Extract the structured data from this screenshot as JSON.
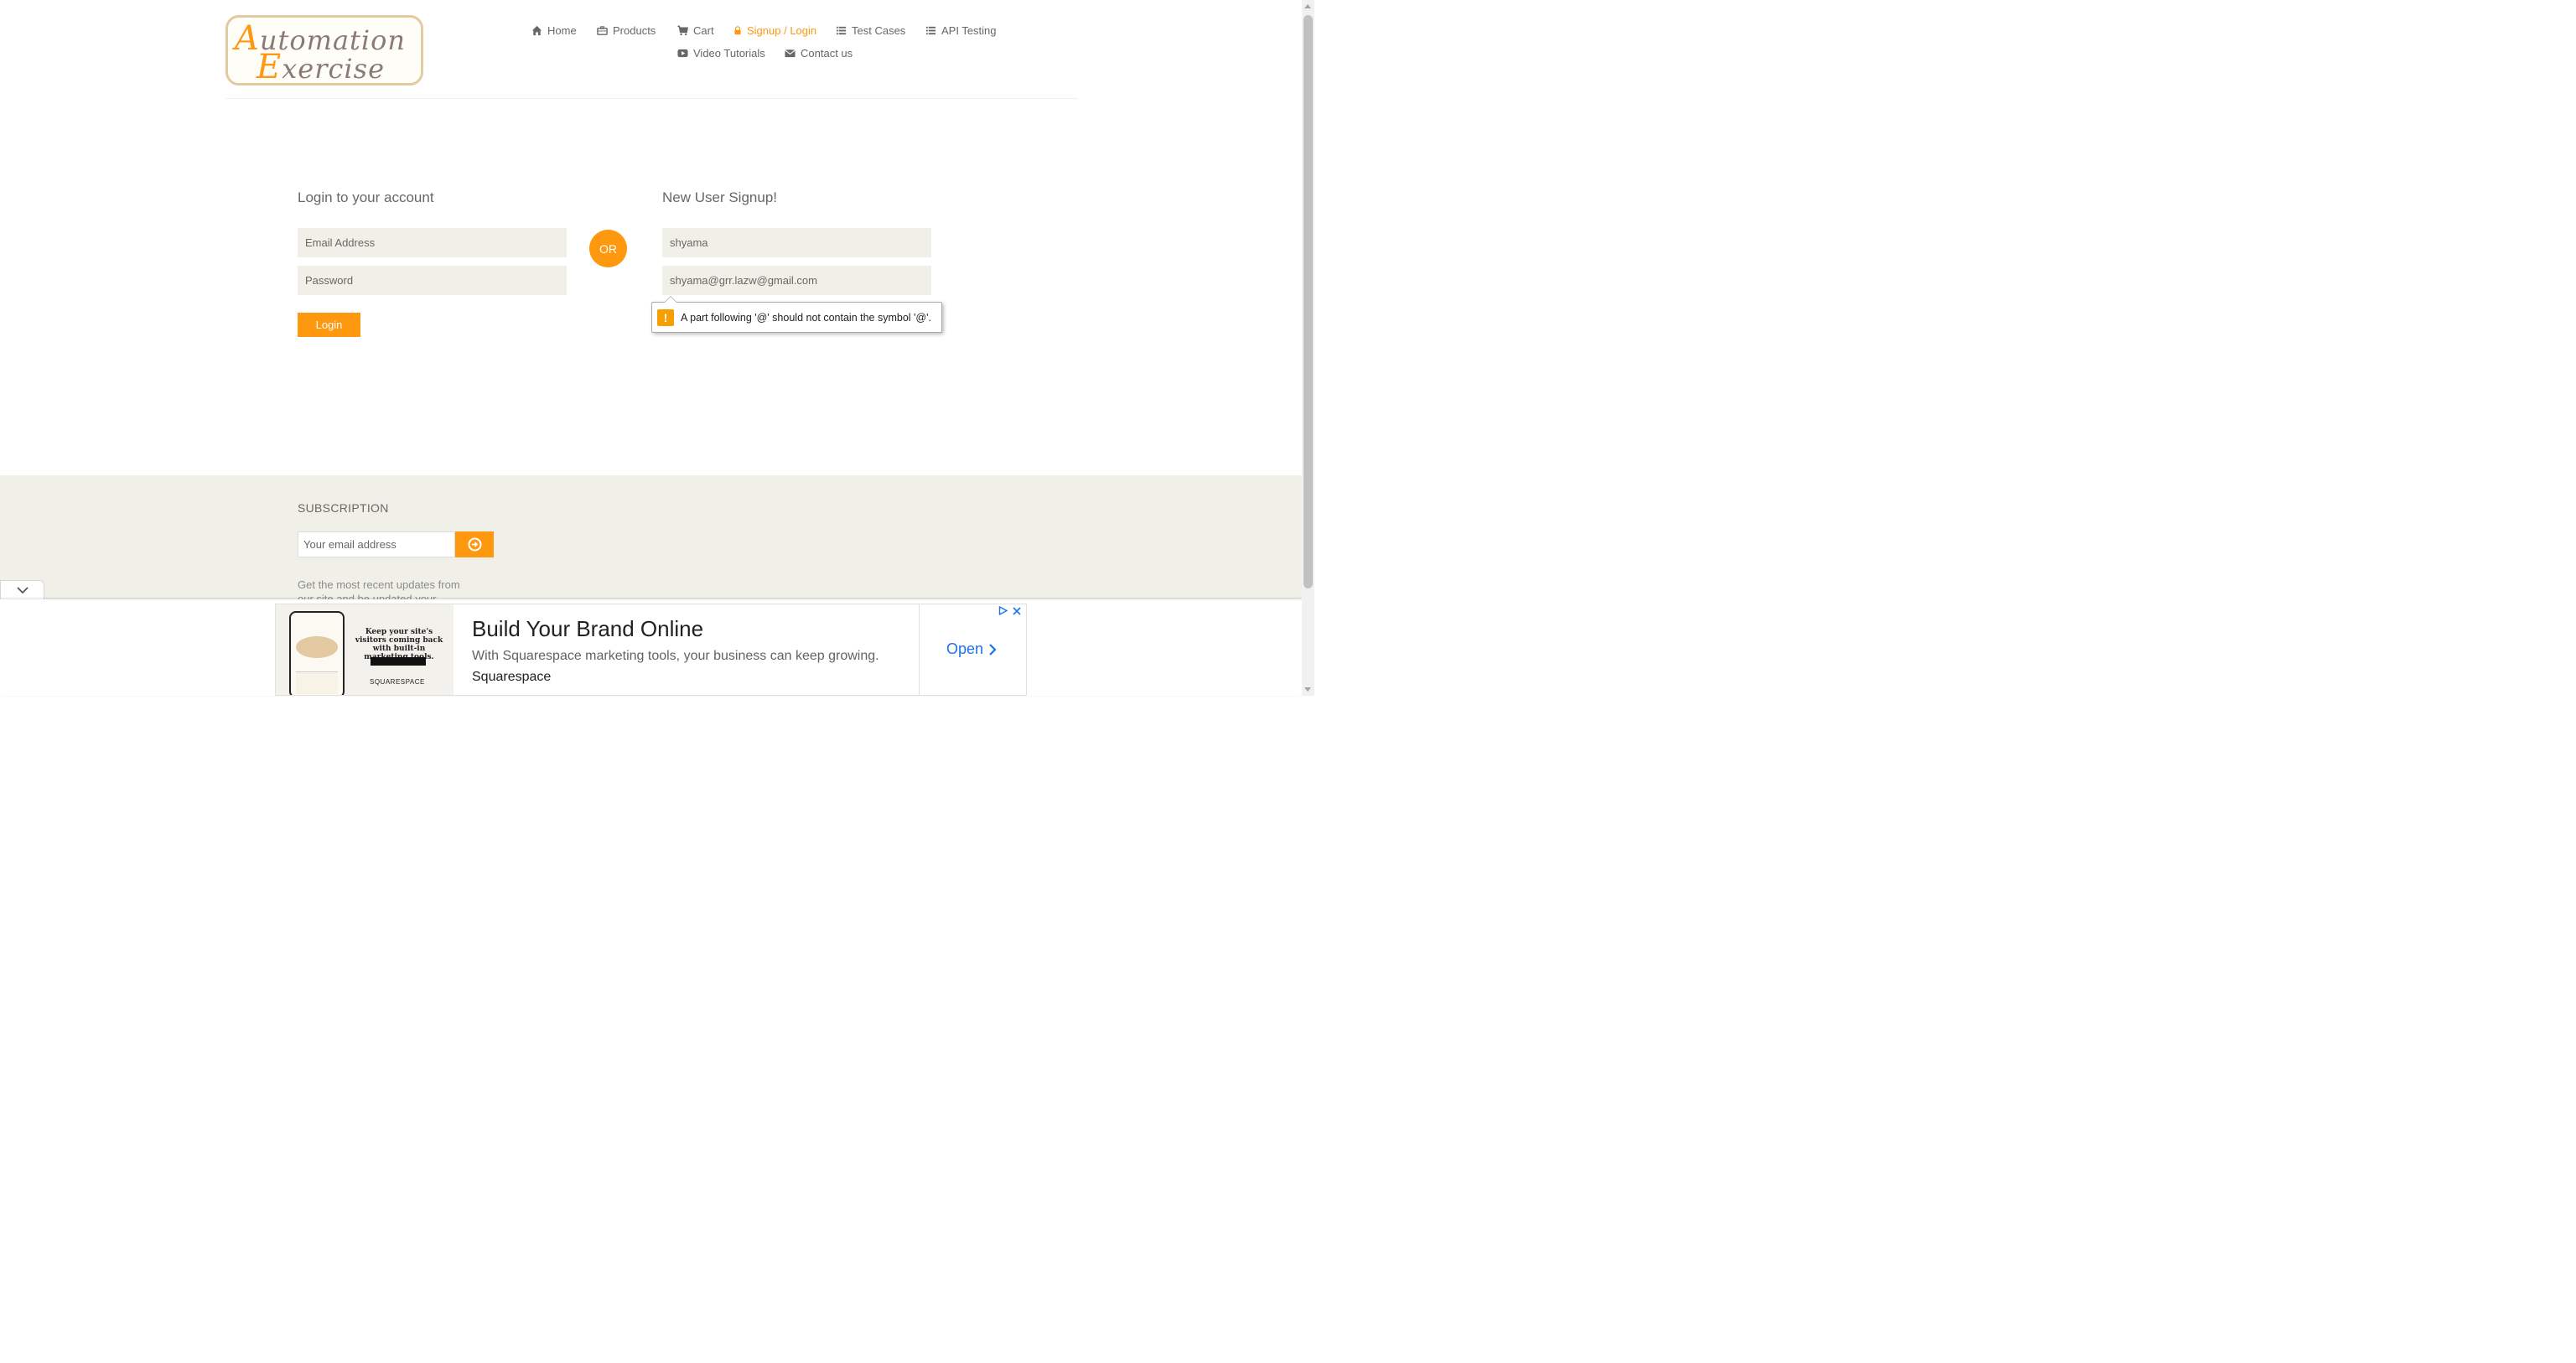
{
  "header": {
    "logo_word1": "Automation",
    "logo_word2": "Exercise",
    "nav": [
      {
        "label": "Home",
        "icon": "home-icon"
      },
      {
        "label": "Products",
        "icon": "briefcase-icon"
      },
      {
        "label": "Cart",
        "icon": "cart-icon"
      },
      {
        "label": "Signup / Login",
        "icon": "lock-icon",
        "active": true
      },
      {
        "label": "Test Cases",
        "icon": "list-icon"
      },
      {
        "label": "API Testing",
        "icon": "list-icon"
      },
      {
        "label": "Video Tutorials",
        "icon": "youtube-play-icon"
      },
      {
        "label": "Contact us",
        "icon": "envelope-icon"
      }
    ]
  },
  "login": {
    "title": "Login to your account",
    "email_placeholder": "Email Address",
    "password_placeholder": "Password",
    "button": "Login"
  },
  "or_label": "OR",
  "signup": {
    "title": "New User Signup!",
    "name_value": "shyama",
    "email_value": "shyama@grr.lazw@gmail.com",
    "validation_message": "A part following '@' should not contain the symbol '@'."
  },
  "footer": {
    "subscription_title": "SUBSCRIPTION",
    "email_placeholder": "Your email address",
    "subscription_text": "Get the most recent updates from our site and be updated your self..."
  },
  "ad": {
    "image_headline": "Keep your site's visitors coming back with built-in marketing tools.",
    "image_brand": "SQUARESPACE",
    "title": "Build Your Brand Online",
    "description": "With Squarespace marketing tools, your business can keep growing.",
    "advertiser": "Squarespace",
    "cta": "Open"
  },
  "colors": {
    "accent": "#fe980f",
    "text": "#696763",
    "field_bg": "#f0f0e9",
    "link_blue": "#1a73e8"
  }
}
